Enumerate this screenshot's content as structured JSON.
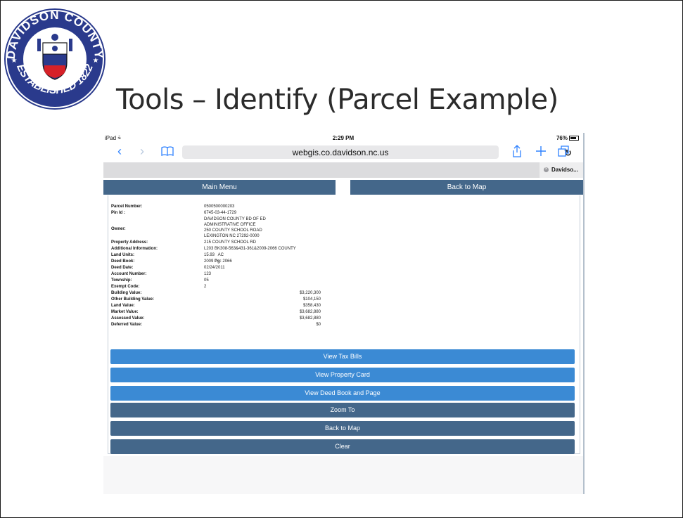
{
  "slide": {
    "title": "Tools – Identify (Parcel Example)",
    "seal": {
      "top_text": "DAVIDSON COUNTY",
      "bottom_text": "ESTABLISHED 1822",
      "colors": {
        "ring": "#2a3a8c",
        "star": "#ffffff",
        "shield_red": "#d62128",
        "shield_blue": "#2a3a8c"
      }
    }
  },
  "device": {
    "status": {
      "carrier": "iPad ⩯",
      "time": "2:29 PM",
      "battery": "76%"
    },
    "browser": {
      "url": "webgis.co.davidson.nc.us",
      "tab_label": "Davidso...",
      "icons": [
        "back-icon",
        "forward-icon",
        "bookmarks-icon",
        "reload-icon",
        "share-icon",
        "new-tab-icon",
        "tabs-icon"
      ]
    }
  },
  "app": {
    "top_buttons": {
      "main_menu": "Main Menu",
      "back_to_map": "Back to Map"
    },
    "parcel": [
      {
        "label": "Parcel Number:",
        "value": "0500500000203"
      },
      {
        "label": "Pin Id :",
        "value": "6745-03-44-1729"
      },
      {
        "label": "Owner:",
        "value": "DAVIDSON COUNTY BD OF ED",
        "value2": "ADMINISTRATIVE OFFICE",
        "value3": "250 COUNTY SCHOOL ROAD",
        "value4": "LEXINGTON NC 27292-0000"
      },
      {
        "label": "Property Address:",
        "value": "215 COUNTY SCHOOL RD"
      },
      {
        "label": "Additional Information:",
        "value": "L203 BK308-563&431-361&2009-2066 COUNTY"
      },
      {
        "label": "Land Units:",
        "value": "15.93   AC"
      },
      {
        "label": "Deed Book:",
        "value": "2009",
        "value_suffix_label": " Pg: ",
        "value_suffix": "2066"
      },
      {
        "label": "Deed Date:",
        "value": "02/24/2011"
      },
      {
        "label": "Account Number:",
        "value": "123"
      },
      {
        "label": "Township:",
        "value": "05"
      },
      {
        "label": "Exempt Code:",
        "value": "2"
      },
      {
        "label": "Building Value:",
        "money": "$3,220,300"
      },
      {
        "label": "Other Building Value:",
        "money": "$104,150"
      },
      {
        "label": "Land Value:",
        "money": "$358,430"
      },
      {
        "label": "Market Value:",
        "money": "$3,682,880"
      },
      {
        "label": "Assessed Value:",
        "money": "$3,682,880"
      },
      {
        "label": "Deferred Value:",
        "money": "$0"
      }
    ],
    "actions": {
      "view_tax_bills": "View Tax Bills",
      "view_property_card": "View Property Card",
      "view_deed_book": "View Deed Book and Page",
      "zoom_to": "Zoom To",
      "back_to_map": "Back to Map",
      "clear": "Clear"
    },
    "colors": {
      "dark_button": "#44678a",
      "light_button": "#3b8ad4",
      "ios_blue": "#2f82ff"
    }
  }
}
